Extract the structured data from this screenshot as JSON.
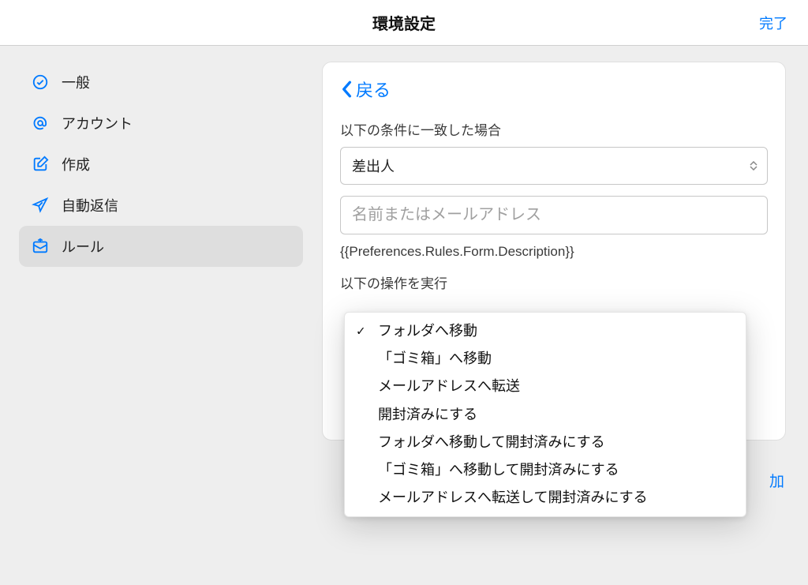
{
  "title": "環境設定",
  "done_label": "完了",
  "sidebar": {
    "items": [
      {
        "icon": "checkmark-circle-icon",
        "label": "一般"
      },
      {
        "icon": "at-icon",
        "label": "アカウント"
      },
      {
        "icon": "compose-icon",
        "label": "作成"
      },
      {
        "icon": "airplane-icon",
        "label": "自動返信"
      },
      {
        "icon": "rules-icon",
        "label": "ルール"
      }
    ],
    "active_index": 4
  },
  "back_label": "戻る",
  "condition_section_label": "以下の条件に一致した場合",
  "condition_select_value": "差出人",
  "condition_input_placeholder": "名前またはメールアドレス",
  "description_text": "{{Preferences.Rules.Form.Description}}",
  "action_section_label": "以下の操作を実行",
  "dropdown": {
    "selected_index": 0,
    "options": [
      "フォルダへ移動",
      "「ゴミ箱」へ移動",
      "メールアドレスへ転送",
      "開封済みにする",
      "フォルダへ移動して開封済みにする",
      "「ゴミ箱」へ移動して開封済みにする",
      "メールアドレスへ転送して開封済みにする"
    ]
  },
  "add_button_fragment": "加",
  "colors": {
    "accent": "#007aff"
  }
}
